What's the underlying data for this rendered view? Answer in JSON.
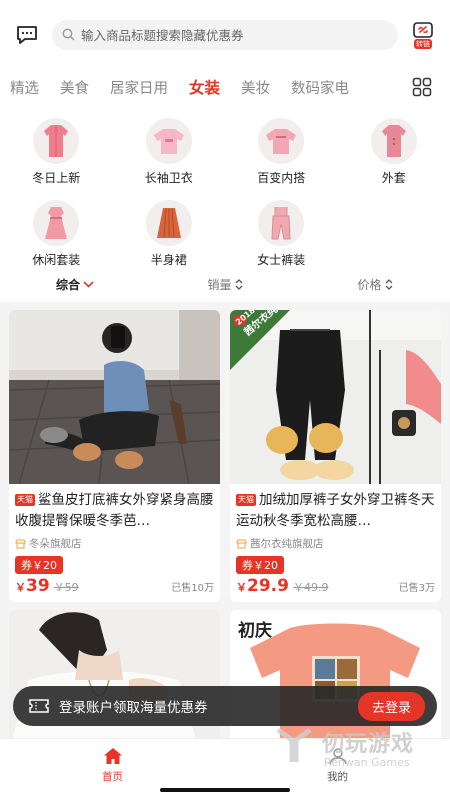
{
  "header": {
    "search_placeholder": "输入商品标题搜索隐藏优惠券",
    "share_label": "转链"
  },
  "tabs": [
    "精选",
    "美食",
    "居家日用",
    "女装",
    "美妆",
    "数码家电"
  ],
  "active_tab": "女装",
  "subcategories": [
    {
      "label": "冬日上新",
      "icon": "pink-coat-icon"
    },
    {
      "label": "长袖卫衣",
      "icon": "pink-sweatshirt-icon"
    },
    {
      "label": "百变内搭",
      "icon": "pink-top-icon"
    },
    {
      "label": "外套",
      "icon": "pink-coat-icon"
    },
    {
      "label": "休闲套装",
      "icon": "dress-icon"
    },
    {
      "label": "半身裙",
      "icon": "skirt-icon"
    },
    {
      "label": "女士裤装",
      "icon": "overalls-icon"
    }
  ],
  "sort": {
    "comprehensive": "综合",
    "sales": "销量",
    "price": "价格"
  },
  "products": [
    {
      "title": "鲨鱼皮打底裤女外穿紧身高腰收腹提臀保暖冬季芭…",
      "badge": "天猫",
      "shop": "冬朵旗舰店",
      "coupon": "券￥20",
      "price_symbol": "￥",
      "price": "39",
      "original_price": "￥59",
      "sold": "已售10万"
    },
    {
      "title": "加绒加厚裤子女外穿卫裤冬天运动秋冬季宽松高腰…",
      "badge": "天猫",
      "shop": "茜尔衣纯旗舰店",
      "coupon": "券￥20",
      "price_symbol": "￥",
      "price": "29.9",
      "original_price": "￥49.9",
      "sold": "已售3万"
    }
  ],
  "image_texts": {
    "pants_tag": "茜尔衣纯",
    "pants_tag_top": "2018",
    "brand": "初庆"
  },
  "login_banner": {
    "text": "登录账户领取海量优惠券",
    "button": "去登录"
  },
  "bottom_nav": [
    {
      "label": "首页",
      "icon": "home-icon",
      "active": true
    },
    {
      "label": "我的",
      "icon": "user-icon",
      "active": false
    }
  ],
  "watermark": {
    "title": "仞玩游戏",
    "subtitle": "Renwan Games"
  },
  "colors": {
    "accent": "#e63427",
    "tab_inactive": "#888888",
    "banner_bg": "#282828"
  }
}
